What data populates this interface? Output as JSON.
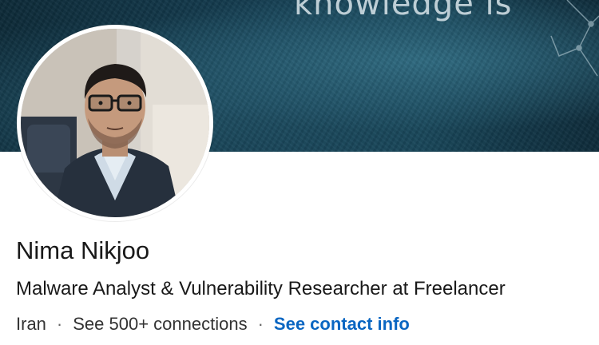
{
  "cover": {
    "banner_text": "knowledge is"
  },
  "profile": {
    "name": "Nima Nikjoo",
    "headline": "Malware Analyst & Vulnerability Researcher at Freelancer",
    "location": "Iran",
    "separator": "·",
    "connections": "See 500+ connections",
    "contact_link": "See contact info"
  },
  "colors": {
    "link": "#0a66c2",
    "text": "#191919",
    "cover": "#153e52"
  }
}
